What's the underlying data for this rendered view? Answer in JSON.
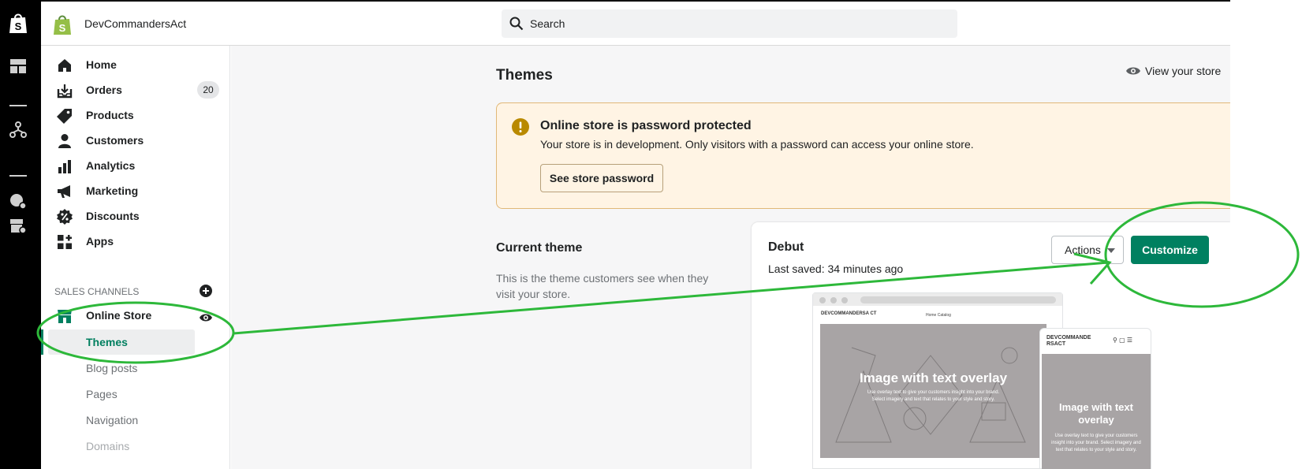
{
  "topbar": {
    "store_name": "DevCommandersAct",
    "search_placeholder": "Search"
  },
  "rail": {
    "icons": [
      "shopify-bag-icon",
      "dashboard-icon",
      "network-icon",
      "user-settings-icon",
      "store-settings-icon"
    ]
  },
  "sidebar": {
    "items": [
      {
        "label": "Home",
        "icon": "home-icon"
      },
      {
        "label": "Orders",
        "icon": "orders-icon",
        "badge": "20"
      },
      {
        "label": "Products",
        "icon": "tag-icon"
      },
      {
        "label": "Customers",
        "icon": "person-icon"
      },
      {
        "label": "Analytics",
        "icon": "bar-chart-icon"
      },
      {
        "label": "Marketing",
        "icon": "megaphone-icon"
      },
      {
        "label": "Discounts",
        "icon": "discount-icon"
      },
      {
        "label": "Apps",
        "icon": "apps-icon"
      }
    ],
    "sales_channels_label": "SALES CHANNELS",
    "channel": {
      "label": "Online Store",
      "icon": "store-icon"
    },
    "sub_items": [
      "Themes",
      "Blog posts",
      "Pages",
      "Navigation",
      "Domains"
    ]
  },
  "main": {
    "title": "Themes",
    "view_store": "View your store",
    "banner": {
      "title": "Online store is password protected",
      "text": "Your store is in development. Only visitors with a password can access your online store.",
      "button": "See store password"
    },
    "current_theme": {
      "title": "Current theme",
      "description": "This is the theme customers see when they visit your store."
    },
    "theme_card": {
      "name": "Debut",
      "last_saved": "Last saved: 34 minutes ago",
      "actions_label": "Actions",
      "customize_label": "Customize"
    },
    "preview": {
      "desktop_store": "DEVCOMMANDERSA CT",
      "desktop_nav": "Home  Catalog",
      "hero_title": "Image with text overlay",
      "hero_sub": "Use overlay text to give your customers insight into your brand. Select imagery and text that relates to your style and story.",
      "mobile_store": "DEVCOMMANDE RSACT",
      "mobile_hero_title": "Image with text overlay",
      "mobile_hero_sub": "Use overlay text to give your customers insight into your brand. Select imagery and text that relates to your style and story."
    }
  },
  "colors": {
    "accent": "#008060",
    "banner_bg": "#fff4e4",
    "annotation": "#2db83a"
  }
}
